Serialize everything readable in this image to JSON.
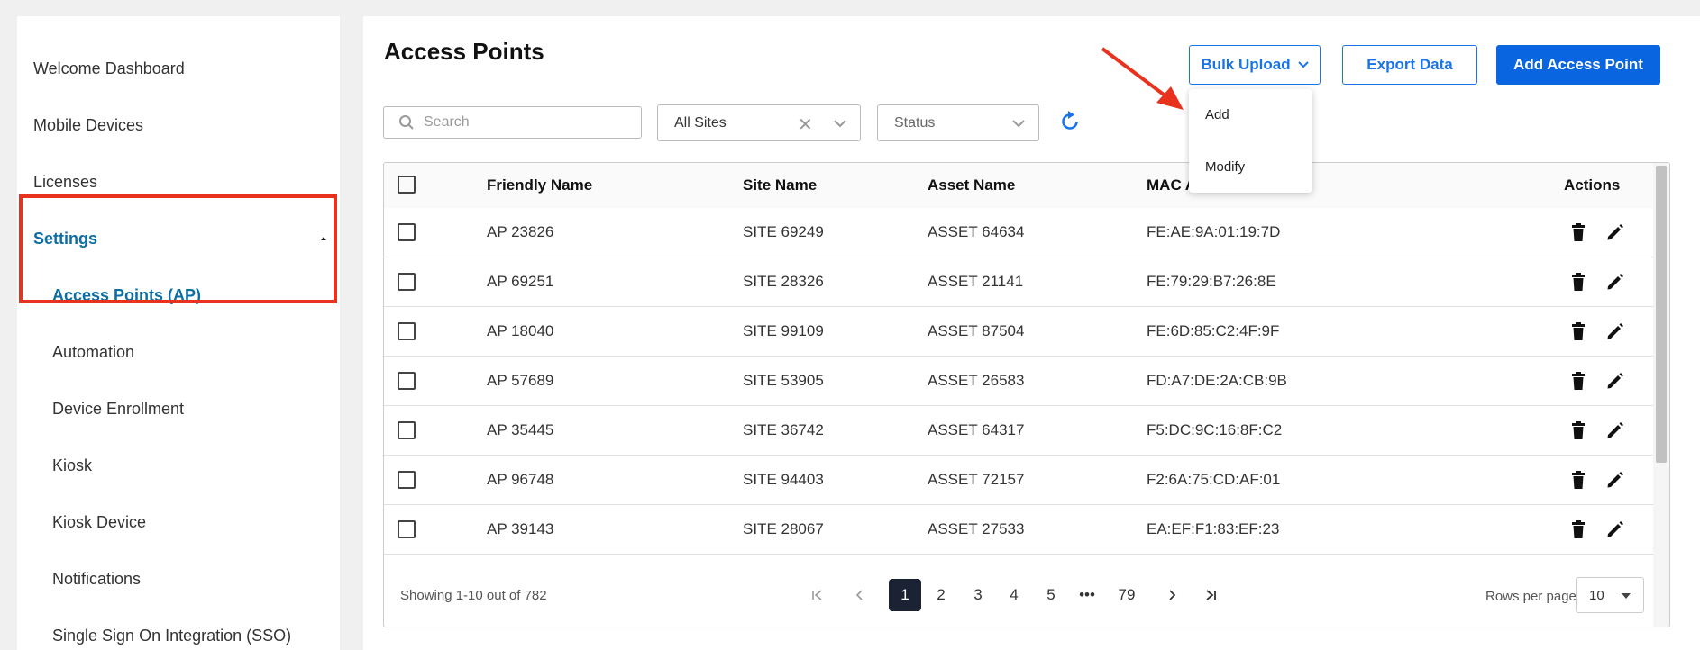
{
  "sidebar": {
    "items": [
      {
        "label": "Welcome Dashboard"
      },
      {
        "label": "Mobile Devices"
      },
      {
        "label": "Licenses"
      },
      {
        "label": "Settings"
      },
      {
        "label": "Access Points (AP)"
      },
      {
        "label": "Automation"
      },
      {
        "label": "Device Enrollment"
      },
      {
        "label": "Kiosk"
      },
      {
        "label": "Kiosk Device"
      },
      {
        "label": "Notifications"
      },
      {
        "label": "Single Sign On Integration (SSO)"
      }
    ]
  },
  "header": {
    "title": "Access Points",
    "bulk_upload_label": "Bulk Upload",
    "export_label": "Export Data",
    "add_label": "Add Access Point"
  },
  "bulk_menu": {
    "items": [
      {
        "label": "Add"
      },
      {
        "label": "Modify"
      }
    ]
  },
  "filters": {
    "search_placeholder": "Search",
    "sites_value": "All Sites",
    "status_placeholder": "Status"
  },
  "table": {
    "columns": [
      "Friendly Name",
      "Site Name",
      "Asset Name",
      "MAC A",
      "Actions"
    ],
    "rows": [
      {
        "friendly": "AP  23826",
        "site": "SITE  69249",
        "asset": "ASSET  64634",
        "mac": "FE:AE:9A:01:19:7D"
      },
      {
        "friendly": "AP  69251",
        "site": "SITE  28326",
        "asset": "ASSET  21141",
        "mac": "FE:79:29:B7:26:8E"
      },
      {
        "friendly": "AP  18040",
        "site": "SITE  99109",
        "asset": "ASSET  87504",
        "mac": "FE:6D:85:C2:4F:9F"
      },
      {
        "friendly": "AP  57689",
        "site": "SITE  53905",
        "asset": "ASSET  26583",
        "mac": "FD:A7:DE:2A:CB:9B"
      },
      {
        "friendly": "AP  35445",
        "site": "SITE  36742",
        "asset": "ASSET  64317",
        "mac": "F5:DC:9C:16:8F:C2"
      },
      {
        "friendly": "AP  96748",
        "site": "SITE  94403",
        "asset": "ASSET  72157",
        "mac": "F2:6A:75:CD:AF:01"
      },
      {
        "friendly": "AP  39143",
        "site": "SITE  28067",
        "asset": "ASSET  27533",
        "mac": "EA:EF:F1:83:EF:23"
      }
    ]
  },
  "pagination": {
    "showing": "Showing 1-10 out of 782",
    "pages": [
      "1",
      "2",
      "3",
      "4",
      "5",
      "•••",
      "79"
    ],
    "current": "1",
    "rows_per_page_label": "Rows per page",
    "rows_per_page_value": "10"
  },
  "colors": {
    "primary": "#0a66e0",
    "active_nav": "#0d6ea3",
    "annotation_red": "#e8321e"
  }
}
